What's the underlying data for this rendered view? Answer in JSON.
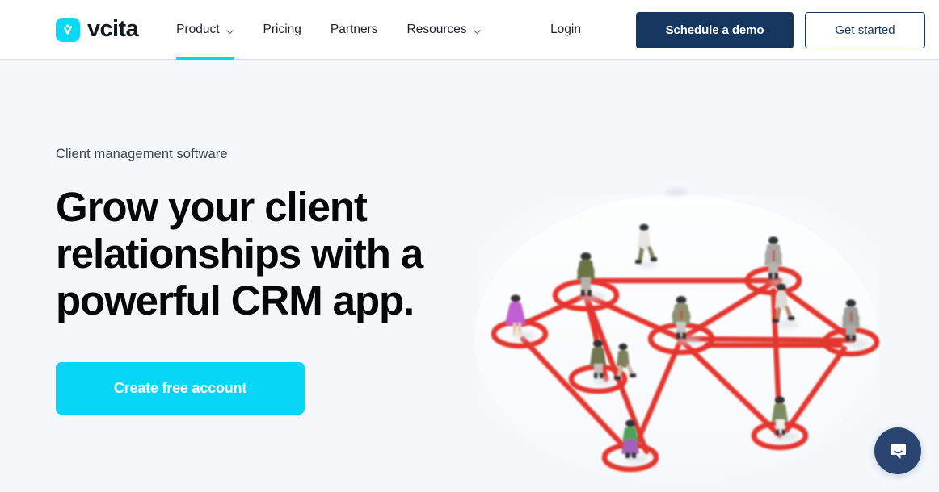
{
  "header": {
    "logo": {
      "text": "vcita",
      "icon": "vcita-check-person-icon",
      "color": "#09d8f7"
    },
    "nav": [
      {
        "label": "Product",
        "has_dropdown": true,
        "active": true,
        "icon": "chevron-down-icon"
      },
      {
        "label": "Pricing",
        "has_dropdown": false,
        "active": false,
        "icon": ""
      },
      {
        "label": "Partners",
        "has_dropdown": false,
        "active": false,
        "icon": ""
      },
      {
        "label": "Resources",
        "has_dropdown": true,
        "active": false,
        "icon": "chevron-down-icon"
      }
    ],
    "login_label": "Login",
    "demo_button_label": "Schedule a demo",
    "get_started_button_label": "Get started",
    "active_underline_color": "#06d6f7",
    "navy": "#15375f"
  },
  "hero": {
    "eyebrow": "Client management software",
    "headline": "Grow your client relationships with a powerful CRM app.",
    "headline_lines": [
      "Grow your client",
      "relationships with a",
      "powerful CRM app."
    ],
    "cta_label": "Create free account",
    "cta_color": "#06d5f6",
    "background_color": "#f4f8fb",
    "image": {
      "name": "figurine-network-photo",
      "description": "Overhead photo of miniature people figurines standing inside red circles connected by red lines, forming a network on a white surface",
      "accent_color": "#e03a3a"
    }
  },
  "chat_widget": {
    "icon": "chat-bubble-smile-icon",
    "color": "#2b4572"
  }
}
